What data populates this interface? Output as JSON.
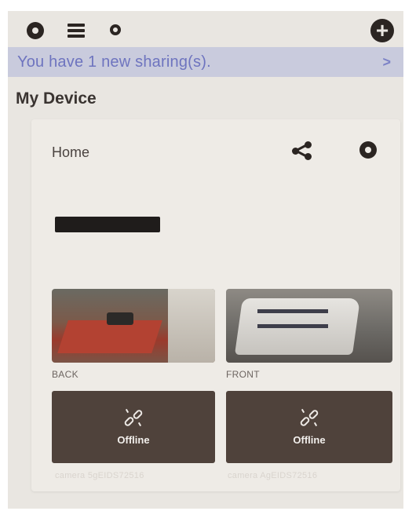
{
  "topbar": {
    "icons": [
      "settings-icon",
      "menu-icon",
      "search-icon",
      "add-icon"
    ]
  },
  "banner": {
    "text": "You have 1 new sharing(s).",
    "arrow": ">"
  },
  "section": {
    "title": "My Device"
  },
  "group": {
    "title": "Home",
    "icons": [
      "share-icon",
      "gear-icon"
    ]
  },
  "cameras": [
    {
      "label": "BACK",
      "status": "Offline",
      "id": "camera 5gEIDS72516"
    },
    {
      "label": "FRONT",
      "status": "Offline",
      "id": "camera AgEIDS72516"
    }
  ],
  "colors": {
    "background": "#e9e6e1",
    "banner_bg": "#c9cbdd",
    "banner_text": "#6e74bf",
    "tile_bg": "#4f423b",
    "icon_dark": "#2b2522"
  }
}
